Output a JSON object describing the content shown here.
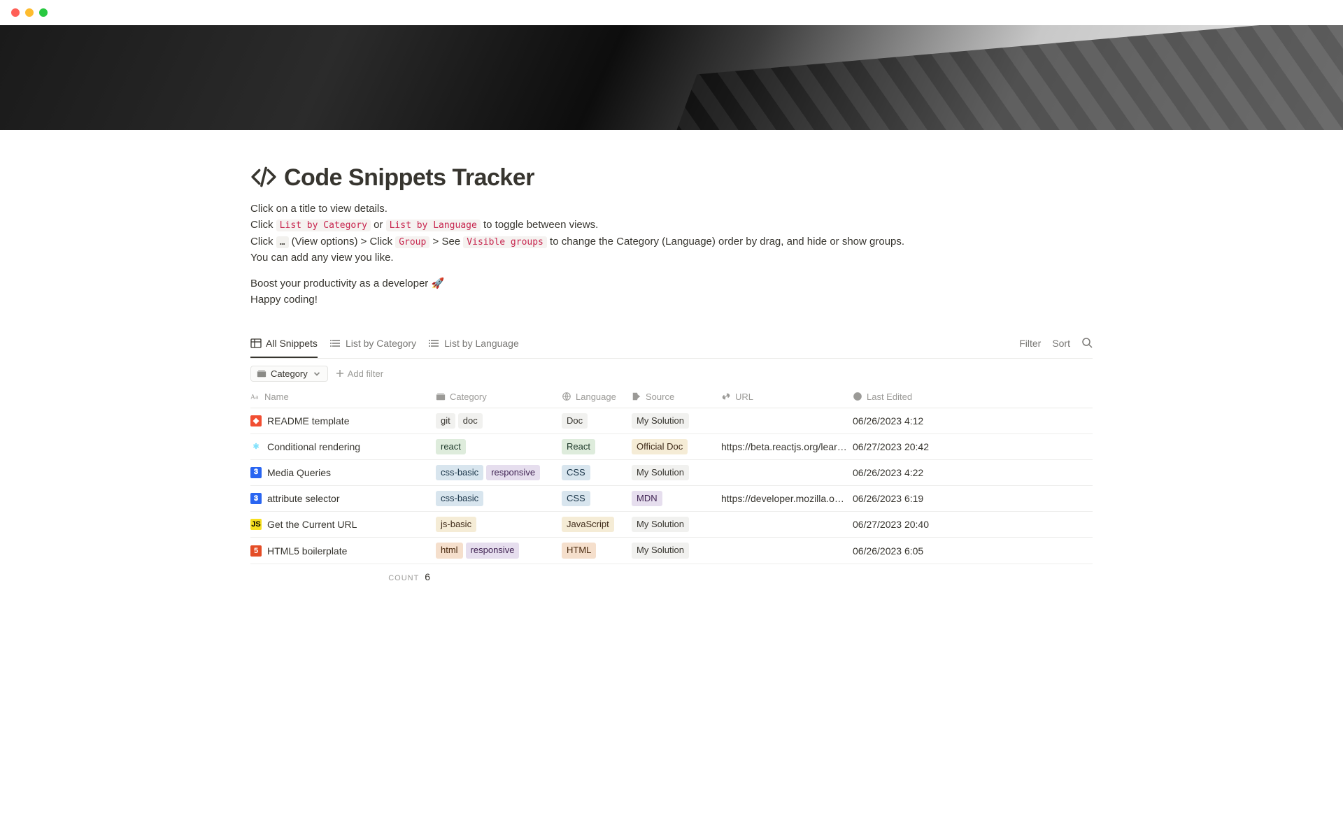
{
  "page": {
    "title": "Code Snippets Tracker",
    "desc_line1": "Click on a title to view details.",
    "desc_click": "Click ",
    "desc_list_cat": "List by Category",
    "desc_or": " or ",
    "desc_list_lang": "List by Language",
    "desc_toggle": " to toggle between views.",
    "desc_line3a": "Click ",
    "desc_ellipsis": "…",
    "desc_line3b": " (View options)  > Click ",
    "desc_group": "Group",
    "desc_line3c": " > See ",
    "desc_visible": "Visible groups",
    "desc_line3d": " to change the Category (Language) order by drag, and hide or show groups.",
    "desc_line4": "You can add any view you like.",
    "desc_line5": "Boost your productivity as a developer 🚀",
    "desc_line6": "Happy coding!"
  },
  "views": {
    "tab1": "All Snippets",
    "tab2": "List by Category",
    "tab3": "List by Language",
    "filter_btn": "Filter",
    "sort_btn": "Sort"
  },
  "filters": {
    "category_chip": "Category",
    "add_filter": "Add filter"
  },
  "columns": {
    "name": "Name",
    "category": "Category",
    "language": "Language",
    "source": "Source",
    "url": "URL",
    "last_edited": "Last Edited"
  },
  "rows": [
    {
      "icon": "git",
      "name": "README template",
      "cats": [
        {
          "t": "git",
          "c": "gray"
        },
        {
          "t": "doc",
          "c": "gray"
        }
      ],
      "lang": {
        "t": "Doc",
        "c": "gray"
      },
      "src": {
        "t": "My Solution",
        "c": "gray"
      },
      "url": "",
      "edited": "06/26/2023 4:12"
    },
    {
      "icon": "react",
      "name": "Conditional rendering",
      "cats": [
        {
          "t": "react",
          "c": "green"
        }
      ],
      "lang": {
        "t": "React",
        "c": "green"
      },
      "src": {
        "t": "Official Doc",
        "c": "yellow"
      },
      "url": "https://beta.reactjs.org/learn#",
      "edited": "06/27/2023 20:42"
    },
    {
      "icon": "css",
      "name": "Media Queries",
      "cats": [
        {
          "t": "css-basic",
          "c": "blue"
        },
        {
          "t": "responsive",
          "c": "purple"
        }
      ],
      "lang": {
        "t": "CSS",
        "c": "blue"
      },
      "src": {
        "t": "My Solution",
        "c": "gray"
      },
      "url": "",
      "edited": "06/26/2023 4:22"
    },
    {
      "icon": "css",
      "name": "attribute selector",
      "cats": [
        {
          "t": "css-basic",
          "c": "blue"
        }
      ],
      "lang": {
        "t": "CSS",
        "c": "blue"
      },
      "src": {
        "t": "MDN",
        "c": "purple"
      },
      "url": "https://developer.mozilla.org/j",
      "edited": "06/26/2023 6:19"
    },
    {
      "icon": "js",
      "name": "Get the Current URL",
      "cats": [
        {
          "t": "js-basic",
          "c": "yellow"
        }
      ],
      "lang": {
        "t": "JavaScript",
        "c": "yellow"
      },
      "src": {
        "t": "My Solution",
        "c": "gray"
      },
      "url": "",
      "edited": "06/27/2023 20:40"
    },
    {
      "icon": "html",
      "name": "HTML5 boilerplate",
      "cats": [
        {
          "t": "html",
          "c": "orange"
        },
        {
          "t": "responsive",
          "c": "purple"
        }
      ],
      "lang": {
        "t": "HTML",
        "c": "orange"
      },
      "src": {
        "t": "My Solution",
        "c": "gray"
      },
      "url": "",
      "edited": "06/26/2023 6:05"
    }
  ],
  "summary": {
    "count_label": "COUNT",
    "count_value": "6"
  }
}
